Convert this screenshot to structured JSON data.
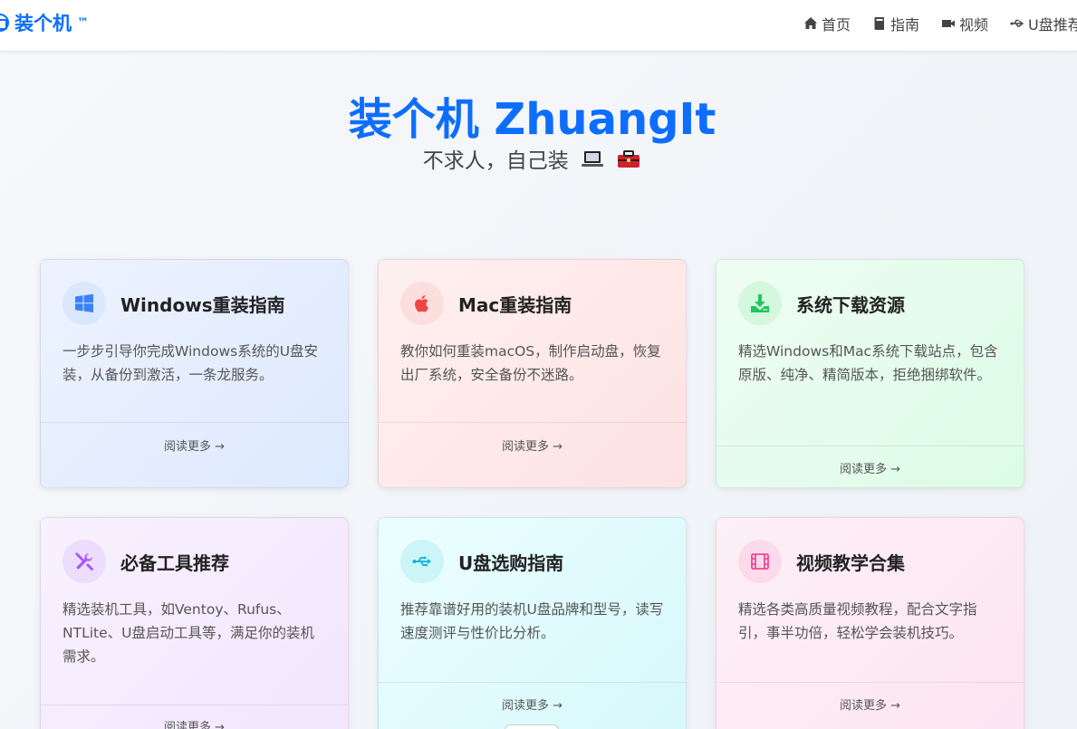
{
  "brand": {
    "name": "装个机",
    "tm": "™"
  },
  "nav": [
    {
      "label": "首页",
      "icon": "home-icon"
    },
    {
      "label": "指南",
      "icon": "book-icon"
    },
    {
      "label": "视频",
      "icon": "video-icon"
    },
    {
      "label": "U盘推荐",
      "icon": "usb-icon"
    }
  ],
  "hero": {
    "title": "装个机 ZhuangIt",
    "subtitle": "不求人，自己装"
  },
  "cards": [
    {
      "title": "Windows重装指南",
      "desc": "一步步引导你完成Windows系统的U盘安装，从备份到激活，一条龙服务。",
      "more": "阅读更多 →",
      "icon": "windows-icon",
      "accent": "#3b82f6",
      "iconBg": "#dbe7fd"
    },
    {
      "title": "Mac重装指南",
      "desc": "教你如何重装macOS，制作启动盘，恢复出厂系统，安全备份不迷路。",
      "more": "阅读更多 →",
      "icon": "apple-icon",
      "accent": "#ef4444",
      "iconBg": "#fcdede"
    },
    {
      "title": "系统下载资源",
      "desc": "精选Windows和Mac系统下载站点，包含原版、纯净、精简版本，拒绝捆绑软件。",
      "more": "阅读更多 →",
      "icon": "download-icon",
      "accent": "#22c55e",
      "iconBg": "#d3f8de"
    },
    {
      "title": "必备工具推荐",
      "desc": "精选装机工具，如Ventoy、Rufus、NTLite、U盘启动工具等，满足你的装机需求。",
      "more": "阅读更多 →",
      "icon": "tools-icon",
      "accent": "#a855f7",
      "iconBg": "#ecdcfd"
    },
    {
      "title": "U盘选购指南",
      "desc": "推荐靠谱好用的装机U盘品牌和型号，读写速度测评与性价比分析。",
      "more": "阅读更多 →",
      "icon": "usb-icon",
      "accent": "#06b6d4",
      "iconBg": "#cdf4f9"
    },
    {
      "title": "视频教学合集",
      "desc": "精选各类高质量视频教程，配合文字指引，事半功倍，轻松学会装机技巧。",
      "more": "阅读更多 →",
      "icon": "film-icon",
      "accent": "#ec4899",
      "iconBg": "#fbdaeb"
    }
  ]
}
